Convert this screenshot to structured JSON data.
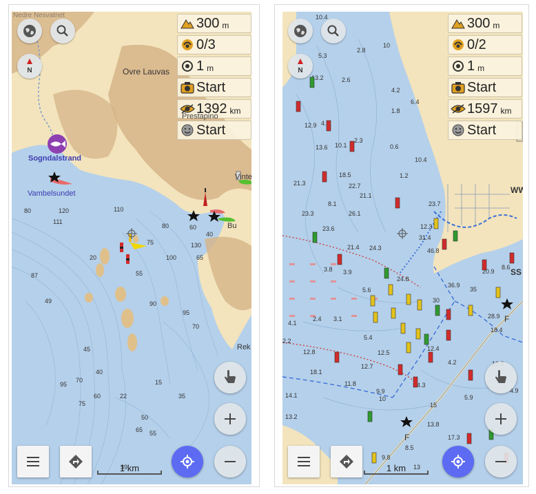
{
  "colors": {
    "water": "#b5d0ea",
    "land": "#f3e4bd",
    "relief": "#d6b488",
    "accent": "#5c6bf2"
  },
  "left": {
    "widgets": [
      {
        "icon": "altitude-icon",
        "value": "300",
        "unit": "m"
      },
      {
        "icon": "satellite-icon",
        "value": "0/3",
        "unit": ""
      },
      {
        "icon": "accuracy-icon",
        "value": "1",
        "unit": "m"
      },
      {
        "icon": "camera-icon",
        "value": "Start",
        "unit": ""
      },
      {
        "icon": "eye-distance-icon",
        "value": "1392",
        "unit": "km"
      },
      {
        "icon": "smiley-icon",
        "value": "Start",
        "unit": ""
      }
    ],
    "places": {
      "ovre_lauvas": "Ovre Lauvas",
      "prestapino": "Prestapino",
      "sogndalstrand": "Sogndalstrand",
      "vambelsundet": "Vambelsundet",
      "vinte": "Vinte",
      "bu": "Bu",
      "rek": "Rek",
      "top_left": "Nedre Nesvatnet"
    },
    "depths": [
      "80",
      "120",
      "111",
      "110",
      "80",
      "60",
      "40",
      "130",
      "75",
      "100",
      "65",
      "20",
      "55",
      "87",
      "49",
      "90",
      "95",
      "70",
      "45",
      "40",
      "95",
      "70",
      "60",
      "22",
      "75",
      "15",
      "35",
      "50",
      "65",
      "55",
      "39"
    ],
    "scale_label": "1 km"
  },
  "right": {
    "widgets": [
      {
        "icon": "altitude-icon",
        "value": "300",
        "unit": "m"
      },
      {
        "icon": "satellite-icon",
        "value": "0/2",
        "unit": ""
      },
      {
        "icon": "accuracy-icon",
        "value": "1",
        "unit": "m"
      },
      {
        "icon": "camera-icon",
        "value": "Start",
        "unit": ""
      },
      {
        "icon": "eye-distance-icon",
        "value": "1597",
        "unit": "km"
      },
      {
        "icon": "smiley-icon",
        "value": "Start",
        "unit": ""
      }
    ],
    "places": {
      "ww": "WW",
      "ss": "SS",
      "f1": "F",
      "f2": "F"
    },
    "depths": [
      "10.4",
      "5.3",
      "2.8",
      "10",
      "13.2",
      "2.6",
      "4.2",
      "6.4",
      "12.9",
      "4.7",
      "1.8",
      "10.1",
      "2.3",
      "13.6",
      "0.6",
      "10.4",
      "18.5",
      "22.7",
      "1.2",
      "21.3",
      "21.1",
      "23.7",
      "8.1",
      "23.3",
      "26.1",
      "12.3",
      "23.6",
      "31.4",
      "21.4",
      "24.3",
      "46.8",
      "8.6",
      "3.8",
      "3.9",
      "20.9",
      "24.8",
      "36.9",
      "35",
      "5.6",
      "4.1",
      "2.4",
      "3.1",
      "30",
      "28.9",
      "18.4",
      "5.4",
      "12.8",
      "12.5",
      "12.4",
      "4.2",
      "2.2",
      "12.7",
      "10.8",
      "18.1",
      "11.8",
      "14.3",
      "14.1",
      "9.9",
      "10",
      "5.9",
      "4.9",
      "13.2",
      "13.8",
      "15",
      "17.3",
      "8.5",
      "9.8",
      "13"
    ],
    "scale_label": "1 km"
  }
}
